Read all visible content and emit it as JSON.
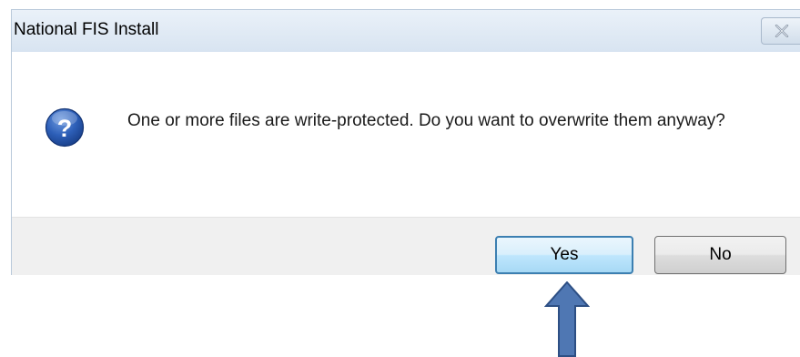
{
  "window": {
    "title": "National FIS Install",
    "close_icon": "close-x-icon"
  },
  "message": {
    "icon": "question-icon",
    "text": "One or more files are write-protected. Do you want to overwrite them anyway?"
  },
  "buttons": {
    "yes_label": "Yes",
    "no_label": "No"
  },
  "annotation": {
    "icon": "up-arrow-icon",
    "color": "#4f77b3"
  },
  "colors": {
    "title_bar": "#dce7f3",
    "footer": "#f0f0f0",
    "default_button_border": "#3c7fb1"
  }
}
